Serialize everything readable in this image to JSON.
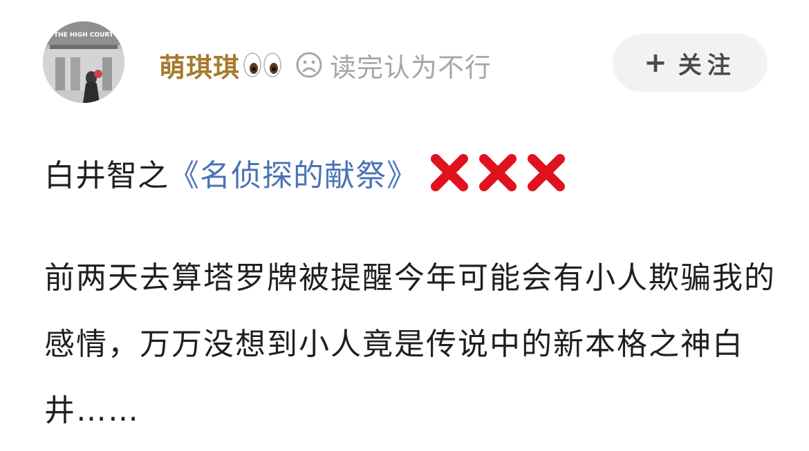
{
  "header": {
    "avatar_caption": "THE HIGH COURT",
    "username": "萌琪琪",
    "eyes_icon": "eyes-emoji-icon",
    "status_icon": "sad-face-icon",
    "status_text": "读完认为不行",
    "follow_button": {
      "plus_icon": "+",
      "label": "关注"
    }
  },
  "post": {
    "title_prefix": "白井智之",
    "book_title": "《名侦探的献祭》",
    "rating_icons": [
      "cross-mark-icon",
      "cross-mark-icon",
      "cross-mark-icon"
    ],
    "body": "前两天去算塔罗牌被提醒今年可能会有小人欺骗我的感情，万万没想到小人竟是传说中的新本格之神白井……"
  },
  "colors": {
    "username": "#a57b2e",
    "link": "#4b73b6",
    "muted": "#a6a6a6",
    "cross": "#e0121f",
    "button_bg": "#f2f2f2"
  }
}
